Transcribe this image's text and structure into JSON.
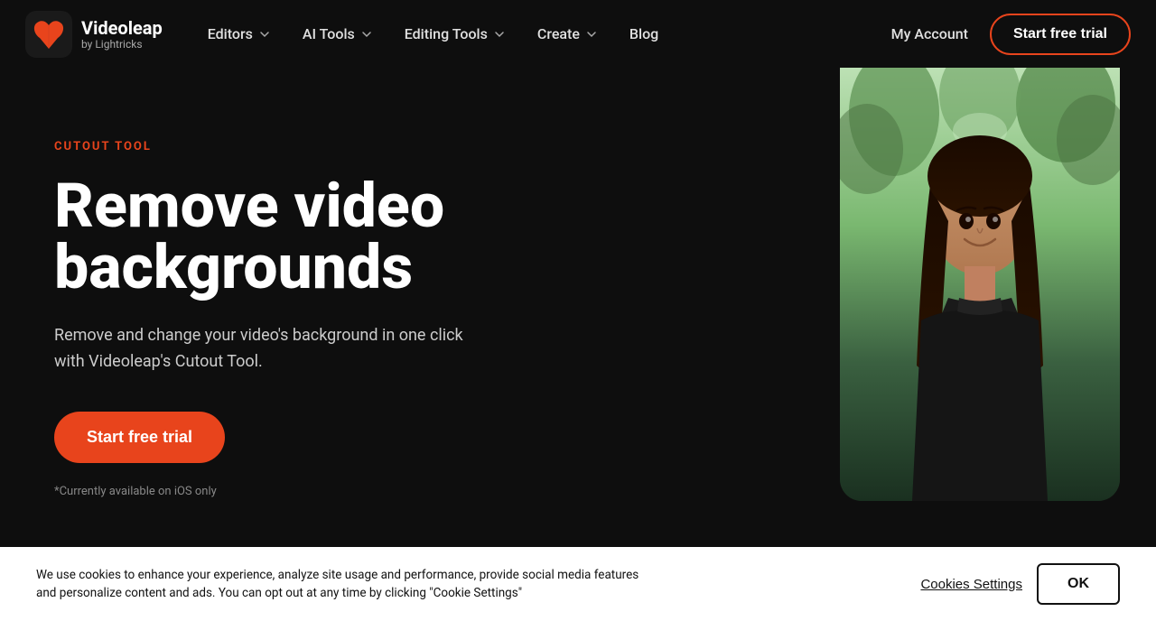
{
  "brand": {
    "name": "Videoleap",
    "subtitle": "by Lightricks"
  },
  "nav": {
    "items": [
      {
        "label": "Editors",
        "hasDropdown": true
      },
      {
        "label": "AI Tools",
        "hasDropdown": true
      },
      {
        "label": "Editing Tools",
        "hasDropdown": true
      },
      {
        "label": "Create",
        "hasDropdown": true
      },
      {
        "label": "Blog",
        "hasDropdown": false
      },
      {
        "label": "My Account",
        "hasDropdown": false
      }
    ],
    "cta": "Start free trial"
  },
  "hero": {
    "tag": "CUTOUT TOOL",
    "title": "Remove video backgrounds",
    "description": "Remove and change your video's background in one click with Videoleap's Cutout Tool.",
    "cta": "Start free trial",
    "note": "*Currently available on iOS only"
  },
  "cookie": {
    "message": "We use cookies to enhance your experience, analyze site usage and performance, provide social media features and personalize content and ads. You can opt out at any time by clicking \"Cookie Settings\"",
    "settings_label": "Cookies Settings",
    "ok_label": "OK"
  },
  "colors": {
    "accent": "#e8441c",
    "bg": "#0e0e0e",
    "text_primary": "#ffffff",
    "text_secondary": "#cccccc",
    "text_muted": "#888888"
  }
}
